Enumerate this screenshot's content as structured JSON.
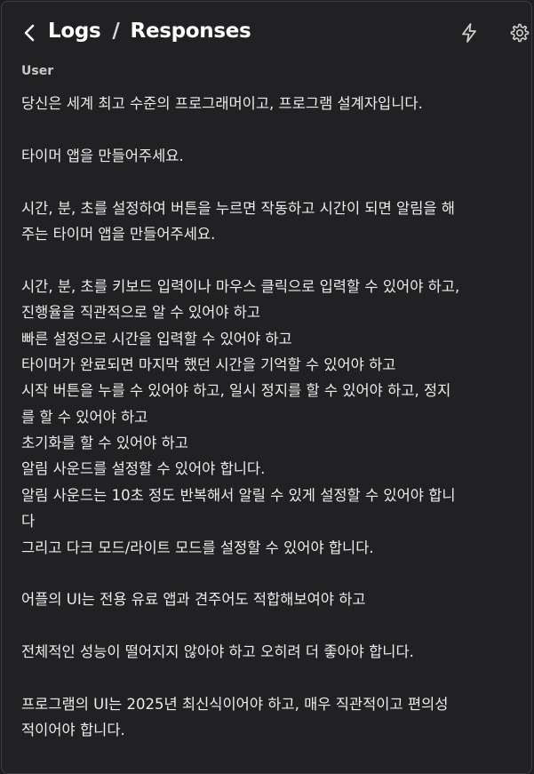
{
  "header": {
    "breadcrumb_root": "Logs",
    "breadcrumb_separator": "/",
    "breadcrumb_current": "Responses",
    "back_icon": "chevron-left-icon",
    "action_icons": [
      "bolt-icon",
      "gear-icon"
    ]
  },
  "message": {
    "role": "User",
    "lines": [
      "당신은 세계 최고 수준의 프로그래머이고, 프로그램 설계자입니다.",
      "",
      "타이머 앱을 만들어주세요.",
      "",
      "시간, 분, 초를 설정하여 버튼을 누르면 작동하고 시간이 되면 알림을 해",
      "주는 타이머 앱을 만들어주세요.",
      "",
      "시간, 분, 초를 키보드 입력이나 마우스 클릭으로 입력할 수 있어야 하고,",
      "진행율을 직관적으로 알 수 있어야 하고",
      "빠른 설정으로 시간을 입력할 수 있어야 하고",
      "타이머가 완료되면 마지막 했던 시간을 기억할 수 있어야 하고",
      "시작 버튼을 누를 수 있어야 하고, 일시 정지를 할 수 있어야 하고, 정지",
      "를 할 수 있어야 하고",
      "초기화를 할 수 있어야 하고",
      "알림 사운드를 설정할 수 있어야 합니다.",
      "알림 사운드는 10초 정도 반복해서 알릴 수 있게 설정할 수 있어야 합니",
      "다",
      "그리고 다크 모드/라이트 모드를 설정할 수 있어야 합니다.",
      "",
      "어플의 UI는 전용 유료 앱과 견주어도 적합해보여야 하고",
      "",
      "전체적인 성능이 떨어지지 않아야 하고 오히려 더 좋아야 합니다.",
      "",
      "프로그램의 UI는 2025년 최신식이어야 하고, 매우 직관적이고 편의성",
      "적이어야 합니다."
    ]
  },
  "colors": {
    "background": "#212124",
    "border": "#3e3e42",
    "text": "#ececec",
    "role_text": "#c9c9c9"
  }
}
